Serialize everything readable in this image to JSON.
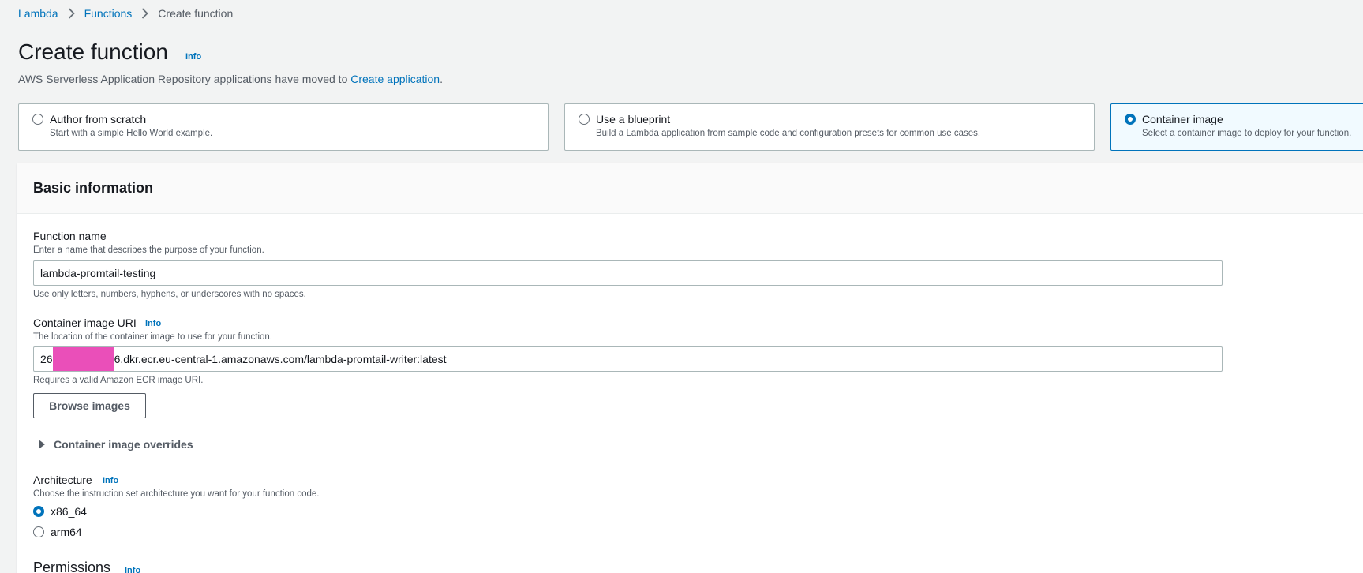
{
  "breadcrumb": {
    "items": [
      "Lambda",
      "Functions"
    ],
    "current": "Create function"
  },
  "header": {
    "title": "Create function",
    "info": "Info",
    "subtitle_prefix": "AWS Serverless Application Repository applications have moved to ",
    "subtitle_link": "Create application",
    "subtitle_suffix": "."
  },
  "options": [
    {
      "title": "Author from scratch",
      "desc": "Start with a simple Hello World example.",
      "selected": false
    },
    {
      "title": "Use a blueprint",
      "desc": "Build a Lambda application from sample code and configuration presets for common use cases.",
      "selected": false
    },
    {
      "title": "Container image",
      "desc": "Select a container image to deploy for your function.",
      "selected": true
    }
  ],
  "basic_info": {
    "title": "Basic information",
    "function_name": {
      "label": "Function name",
      "desc": "Enter a name that describes the purpose of your function.",
      "value": "lambda-promtail-testing",
      "hint": "Use only letters, numbers, hyphens, or underscores with no spaces."
    },
    "image_uri": {
      "label": "Container image URI",
      "info": "Info",
      "desc": "The location of the container image to use for your function.",
      "value_prefix": "26",
      "value_suffix": "6.dkr.ecr.eu-central-1.amazonaws.com/lambda-promtail-writer:latest",
      "hint": "Requires a valid Amazon ECR image URI."
    },
    "browse_button": "Browse images",
    "overrides": "Container image overrides",
    "architecture": {
      "label": "Architecture",
      "info": "Info",
      "desc": "Choose the instruction set architecture you want for your function code.",
      "options": [
        "x86_64",
        "arm64"
      ],
      "selected": "x86_64"
    },
    "permissions": {
      "label": "Permissions",
      "info": "Info"
    }
  },
  "colors": {
    "link": "#0073bb",
    "redaction": "#ea4fb9",
    "selected_tile_bg": "#f1faff"
  }
}
